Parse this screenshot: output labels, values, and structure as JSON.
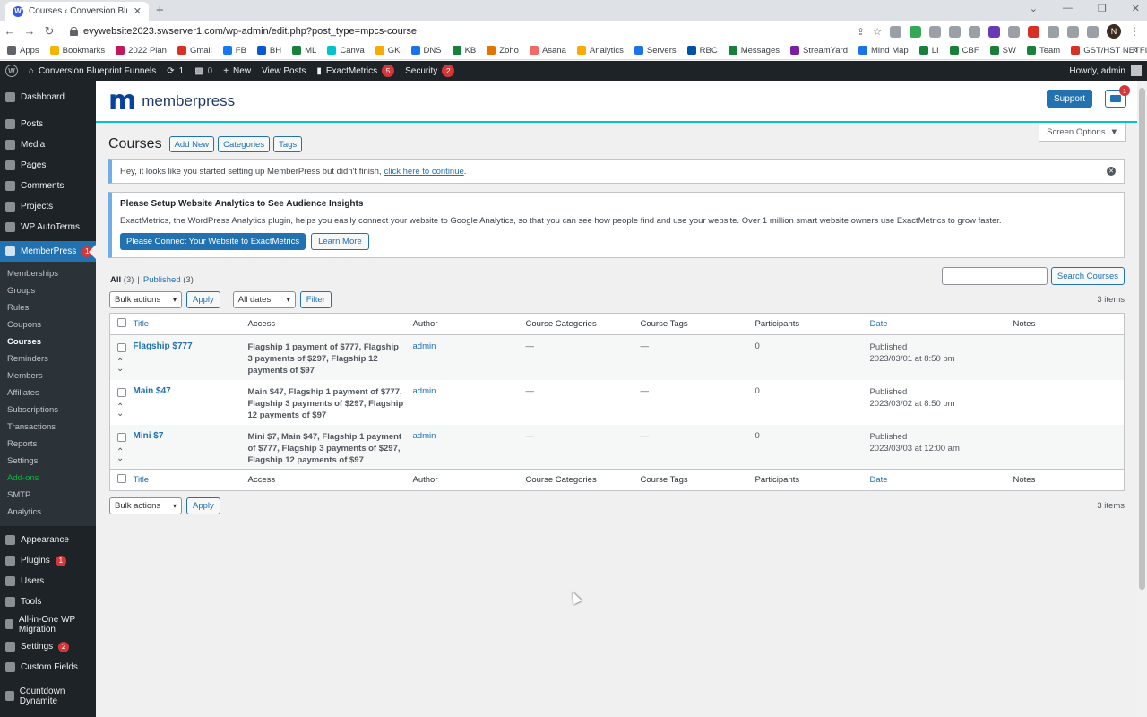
{
  "browser": {
    "tab_title": "Courses ‹ Conversion Blueprint F",
    "url": "evywebsite2023.swserver1.com/wp-admin/edit.php?post_type=mpcs-course",
    "profile_initial": "N",
    "bookmarks": [
      {
        "label": "Apps",
        "color": "#5f6368"
      },
      {
        "label": "Bookmarks",
        "color": "#f4b400"
      },
      {
        "label": "2022 Plan",
        "color": "#c2185b"
      },
      {
        "label": "Gmail",
        "color": "#d93025"
      },
      {
        "label": "FB",
        "color": "#1877f2"
      },
      {
        "label": "BH",
        "color": "#0b57d0"
      },
      {
        "label": "ML",
        "color": "#188038"
      },
      {
        "label": "Canva",
        "color": "#00c4cc"
      },
      {
        "label": "GK",
        "color": "#f9ab00"
      },
      {
        "label": "DNS",
        "color": "#1a73e8"
      },
      {
        "label": "KB",
        "color": "#188038"
      },
      {
        "label": "Zoho",
        "color": "#e37400"
      },
      {
        "label": "Asana",
        "color": "#f06a6a"
      },
      {
        "label": "Analytics",
        "color": "#f9ab00"
      },
      {
        "label": "Servers",
        "color": "#1a73e8"
      },
      {
        "label": "RBC",
        "color": "#0051a5"
      },
      {
        "label": "Messages",
        "color": "#188038"
      },
      {
        "label": "StreamYard",
        "color": "#7b1fa2"
      },
      {
        "label": "Mind Map",
        "color": "#1a73e8"
      },
      {
        "label": "LI",
        "color": "#188038"
      },
      {
        "label": "CBF",
        "color": "#188038"
      },
      {
        "label": "SW",
        "color": "#188038"
      },
      {
        "label": "Team",
        "color": "#188038"
      },
      {
        "label": "GST/HST NETFILE -...",
        "color": "#d93025"
      }
    ],
    "bookmarks_more": "»"
  },
  "adminbar": {
    "site_name": "Conversion Blueprint Funnels",
    "updates_count": "1",
    "comments_count": "0",
    "new_label": "New",
    "view_posts_label": "View Posts",
    "exactmetrics_label": "ExactMetrics",
    "exactmetrics_count": "5",
    "security_label": "Security",
    "security_count": "2",
    "howdy": "Howdy, admin"
  },
  "sidebar": {
    "top_items": [
      {
        "label": "Dashboard"
      },
      {
        "label": "Posts"
      },
      {
        "label": "Media"
      },
      {
        "label": "Pages"
      },
      {
        "label": "Comments"
      },
      {
        "label": "Projects"
      },
      {
        "label": "WP AutoTerms"
      }
    ],
    "memberpress_label": "MemberPress",
    "memberpress_count": "1",
    "submenu": [
      "Memberships",
      "Groups",
      "Rules",
      "Coupons",
      "Courses",
      "Reminders",
      "Members",
      "Affiliates",
      "Subscriptions",
      "Transactions",
      "Reports",
      "Settings",
      "Add-ons",
      "SMTP",
      "Analytics"
    ],
    "bottom_items": [
      {
        "label": "Appearance",
        "badge": ""
      },
      {
        "label": "Plugins",
        "badge": "1"
      },
      {
        "label": "Users",
        "badge": ""
      },
      {
        "label": "Tools",
        "badge": ""
      },
      {
        "label": "All-in-One WP Migration",
        "badge": ""
      },
      {
        "label": "Settings",
        "badge": "2"
      },
      {
        "label": "Custom Fields",
        "badge": ""
      },
      {
        "label": "Countdown Dynamite",
        "badge": ""
      }
    ]
  },
  "header": {
    "logo_text": "memberpress",
    "support_label": "Support",
    "inbox_count": "1"
  },
  "page": {
    "title": "Courses",
    "add_new": "Add New",
    "categories": "Categories",
    "tags": "Tags",
    "screen_options": "Screen Options"
  },
  "notices": {
    "setup_text": "Hey, it looks like you started setting up MemberPress but didn't finish,",
    "setup_link": "click here to continue",
    "setup_end": ".",
    "analytics_title": "Please Setup Website Analytics to See Audience Insights",
    "analytics_text": "ExactMetrics, the WordPress Analytics plugin, helps you easily connect your website to Google Analytics, so that you can see how people find and use your website. Over 1 million smart website owners use ExactMetrics to grow faster.",
    "connect_label": "Please Connect Your Website to ExactMetrics",
    "learn_more_label": "Learn More"
  },
  "filters": {
    "all_label": "All",
    "all_count": "(3)",
    "separator": "|",
    "published_label": "Published",
    "published_count": "(3)",
    "search_placeholder": "",
    "search_button": "Search Courses",
    "bulk_actions": "Bulk actions",
    "apply": "Apply",
    "all_dates": "All dates",
    "filter": "Filter",
    "items_count": "3 items"
  },
  "table": {
    "columns": [
      "Title",
      "Access",
      "Author",
      "Course Categories",
      "Course Tags",
      "Participants",
      "Date",
      "Notes"
    ],
    "rows": [
      {
        "title": "Flagship $777",
        "access": "Flagship 1 payment of $777, Flagship 3 payments of $297, Flagship 12 payments of $97",
        "author": "admin",
        "categories": "—",
        "tags": "—",
        "participants": "0",
        "status": "Published",
        "date": "2023/03/01 at 8:50 pm",
        "notes": ""
      },
      {
        "title": "Main $47",
        "access": "Main $47, Flagship 1 payment of $777, Flagship 3 payments of $297, Flagship 12 payments of $97",
        "author": "admin",
        "categories": "—",
        "tags": "—",
        "participants": "0",
        "status": "Published",
        "date": "2023/03/02 at 8:50 pm",
        "notes": ""
      },
      {
        "title": "Mini $7",
        "access": "Mini $7, Main $47, Flagship 1 payment of $777, Flagship 3 payments of $297, Flagship 12 payments of $97",
        "author": "admin",
        "categories": "—",
        "tags": "—",
        "participants": "0",
        "status": "Published",
        "date": "2023/03/03 at 12:00 am",
        "notes": ""
      }
    ]
  }
}
